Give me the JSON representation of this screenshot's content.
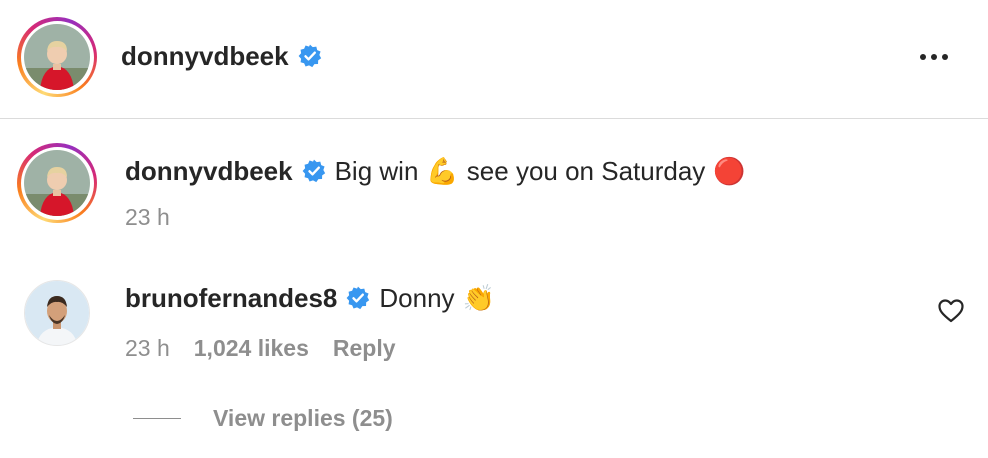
{
  "header": {
    "username": "donnyvdbeek",
    "verified": true
  },
  "caption": {
    "username": "donnyvdbeek",
    "text_part1": "Big win",
    "emoji1": "💪",
    "text_part2": "see you on Saturday",
    "emoji2": "🔴",
    "time": "23 h"
  },
  "comment": {
    "username": "brunofernandes8",
    "text": "Donny",
    "emoji": "👏",
    "time": "23 h",
    "likes": "1,024 likes",
    "reply_label": "Reply",
    "view_replies": "View replies (25)"
  },
  "colors": {
    "verified": "#3897f0",
    "meta": "#8e8e8e",
    "text": "#262626"
  },
  "icons": [
    "more-options-icon",
    "verified-badge-icon",
    "heart-icon"
  ]
}
